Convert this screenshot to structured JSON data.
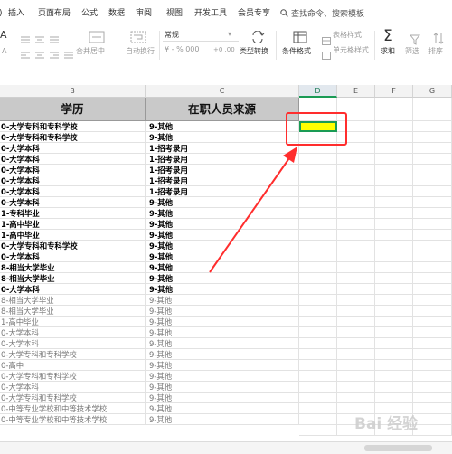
{
  "menu": {
    "items": [
      "插入",
      "页面布局",
      "公式",
      "数据",
      "审阅",
      "视图",
      "开发工具",
      "会员专享"
    ],
    "search_label": "查找命令、搜索模板"
  },
  "ribbon": {
    "merge_center": "合并居中",
    "auto_wrap": "自动换行",
    "number_format": "常规",
    "percent": "¥ - % 000",
    "decimals": "+0 .00",
    "type_convert": "类型转换",
    "conditional_format": "条件格式",
    "table_style": "表格样式",
    "cell_style": "单元格样式",
    "sum": "求和",
    "filter": "筛选",
    "sort": "排序"
  },
  "columns": [
    "B",
    "C",
    "D",
    "E",
    "F",
    "G"
  ],
  "table": {
    "header_b": "学历",
    "header_c": "在职人员来源",
    "rows": [
      {
        "b": "0-大学专科和专科学校",
        "c": "9-其他",
        "bold": true
      },
      {
        "b": "0-大学专科和专科学校",
        "c": "9-其他",
        "bold": true
      },
      {
        "b": "0-大学本科",
        "c": "1-招考录用",
        "bold": true
      },
      {
        "b": "0-大学本科",
        "c": "1-招考录用",
        "bold": true
      },
      {
        "b": "0-大学本科",
        "c": "1-招考录用",
        "bold": true
      },
      {
        "b": "0-大学本科",
        "c": "1-招考录用",
        "bold": true
      },
      {
        "b": "0-大学本科",
        "c": "1-招考录用",
        "bold": true
      },
      {
        "b": "0-大学本科",
        "c": "9-其他",
        "bold": true
      },
      {
        "b": "1-专科毕业",
        "c": "9-其他",
        "bold": true
      },
      {
        "b": "1-高中毕业",
        "c": "9-其他",
        "bold": true
      },
      {
        "b": "1-高中毕业",
        "c": "9-其他",
        "bold": true
      },
      {
        "b": "0-大学专科和专科学校",
        "c": "9-其他",
        "bold": true
      },
      {
        "b": "0-大学本科",
        "c": "9-其他",
        "bold": true
      },
      {
        "b": "8-相当大学毕业",
        "c": "9-其他",
        "bold": true
      },
      {
        "b": "8-相当大学毕业",
        "c": "9-其他",
        "bold": true
      },
      {
        "b": "0-大学本科",
        "c": "9-其他",
        "bold": true
      },
      {
        "b": "8-相当大学毕业",
        "c": "9-其他",
        "bold": false
      },
      {
        "b": "8-相当大学毕业",
        "c": "9-其他",
        "bold": false
      },
      {
        "b": "1-高中毕业",
        "c": "9-其他",
        "bold": false
      },
      {
        "b": "0-大学本科",
        "c": "9-其他",
        "bold": false
      },
      {
        "b": "0-大学本科",
        "c": "9-其他",
        "bold": false
      },
      {
        "b": "0-大学专科和专科学校",
        "c": "9-其他",
        "bold": false
      },
      {
        "b": "0-高中",
        "c": "9-其他",
        "bold": false
      },
      {
        "b": "0-大学专科和专科学校",
        "c": "9-其他",
        "bold": false
      },
      {
        "b": "0-大学本科",
        "c": "9-其他",
        "bold": false
      },
      {
        "b": "0-大学专科和专科学校",
        "c": "9-其他",
        "bold": false
      },
      {
        "b": "0-中等专业学校和中等技术学校",
        "c": "9-其他",
        "bold": false
      },
      {
        "b": "0-中等专业学校和中等技术学校",
        "c": "9-其他",
        "bold": false
      }
    ]
  },
  "watermark": "Bai 经验",
  "colors": {
    "highlight": "#ffff00",
    "selection": "#1a9b55",
    "annotation": "#ff2d2d",
    "header_fill": "#c9c9c9"
  }
}
